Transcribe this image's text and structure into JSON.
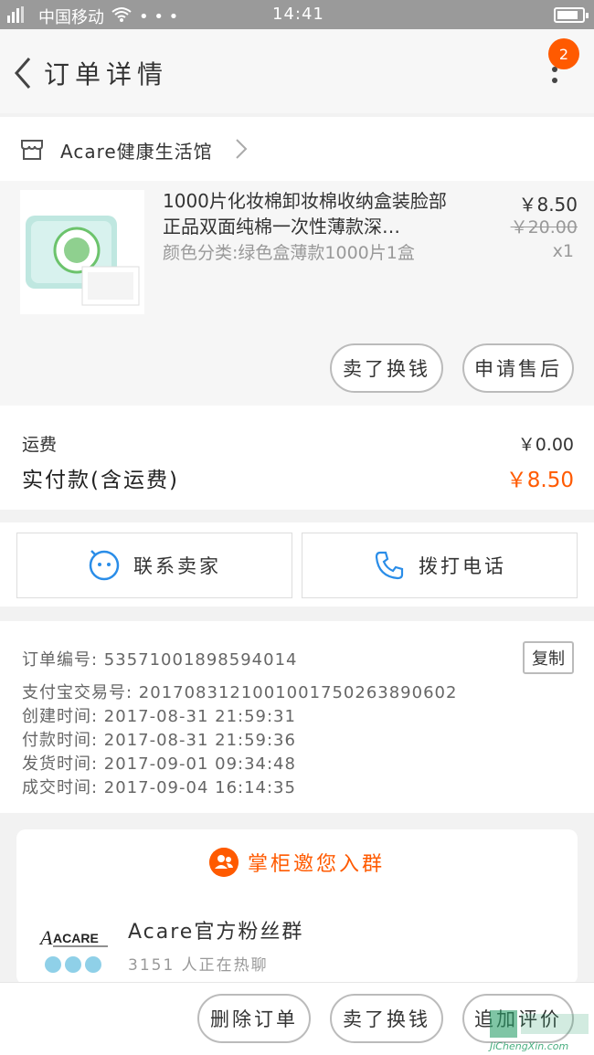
{
  "status_bar": {
    "carrier": "中国移动",
    "time": "14:41"
  },
  "nav": {
    "title": "订单详情",
    "badge_count": "2"
  },
  "store": {
    "name": "Acare健康生活馆"
  },
  "item": {
    "title": "1000片化妆棉卸妆棉收纳盒装脸部正品双面纯棉一次性薄款深…",
    "sku": "颜色分类:绿色盒薄款1000片1盒",
    "price": "￥8.50",
    "original_price": "￥20.00",
    "quantity": "x1",
    "sell_button": "卖了换钱",
    "aftersale_button": "申请售后"
  },
  "fees": {
    "shipping_label": "运费",
    "shipping_value": "￥0.00",
    "paid_label": "实付款(含运费)",
    "paid_value": "￥8.50"
  },
  "contact": {
    "seller_button": "联系卖家",
    "phone_button": "拨打电话"
  },
  "order_info": {
    "order_no": "订单编号: 53571001898594014",
    "alipay_no": "支付宝交易号: 2017083121001001750263890602",
    "created": "创建时间: 2017-08-31  21:59:31",
    "paid": "付款时间: 2017-08-31  21:59:36",
    "shipped": "发货时间: 2017-09-01  09:34:48",
    "completed": "成交时间: 2017-09-04  16:14:35",
    "copy_button": "复制"
  },
  "group": {
    "header": "掌柜邀您入群",
    "name": "Acare官方粉丝群",
    "member_text": "3151 人正在热聊",
    "logo_text": "ACARE"
  },
  "bottom_bar": {
    "delete_button": "删除订单",
    "sell_button": "卖了换钱",
    "review_button": "追加评价"
  },
  "watermark": {
    "text": "JiChengXin.com"
  },
  "colors": {
    "accent": "#ff5a00",
    "icon_blue": "#2a8de8"
  },
  "battery_level": 0.85
}
